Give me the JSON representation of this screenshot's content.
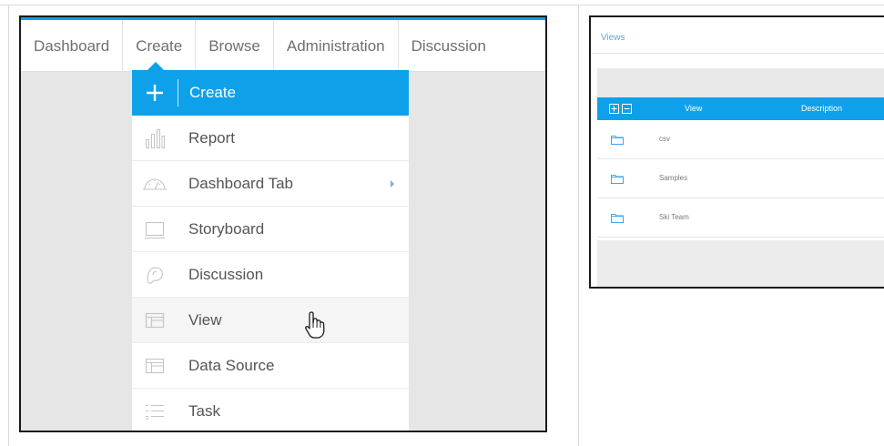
{
  "left_screenshot": {
    "nav": [
      {
        "label": "Dashboard"
      },
      {
        "label": "Create"
      },
      {
        "label": "Browse"
      },
      {
        "label": "Administration"
      },
      {
        "label": "Discussion"
      }
    ],
    "menu": [
      {
        "label": "Create",
        "icon": "plus-icon",
        "state": "active"
      },
      {
        "label": "Report",
        "icon": "bar-chart-icon"
      },
      {
        "label": "Dashboard Tab",
        "icon": "gauge-icon",
        "submenu": true
      },
      {
        "label": "Storyboard",
        "icon": "storyboard-icon"
      },
      {
        "label": "Discussion",
        "icon": "discussion-icon"
      },
      {
        "label": "View",
        "icon": "view-icon",
        "state": "hover"
      },
      {
        "label": "Data Source",
        "icon": "data-source-icon"
      },
      {
        "label": "Task",
        "icon": "task-list-icon"
      }
    ],
    "cursor_icon": "hand-pointer-icon",
    "colors": {
      "accent": "#0ea1ea",
      "background": "#e6e6e6",
      "text": "#555555"
    }
  },
  "right_screenshot": {
    "title": "Views",
    "table": {
      "columns": [
        "View",
        "Description"
      ],
      "header_icons": [
        "expand-all-icon",
        "collapse-all-icon"
      ],
      "rows": [
        {
          "name": "csv",
          "icon": "folder-icon"
        },
        {
          "name": "Samples",
          "icon": "folder-icon"
        },
        {
          "name": "Ski Team",
          "icon": "folder-icon"
        }
      ]
    }
  }
}
